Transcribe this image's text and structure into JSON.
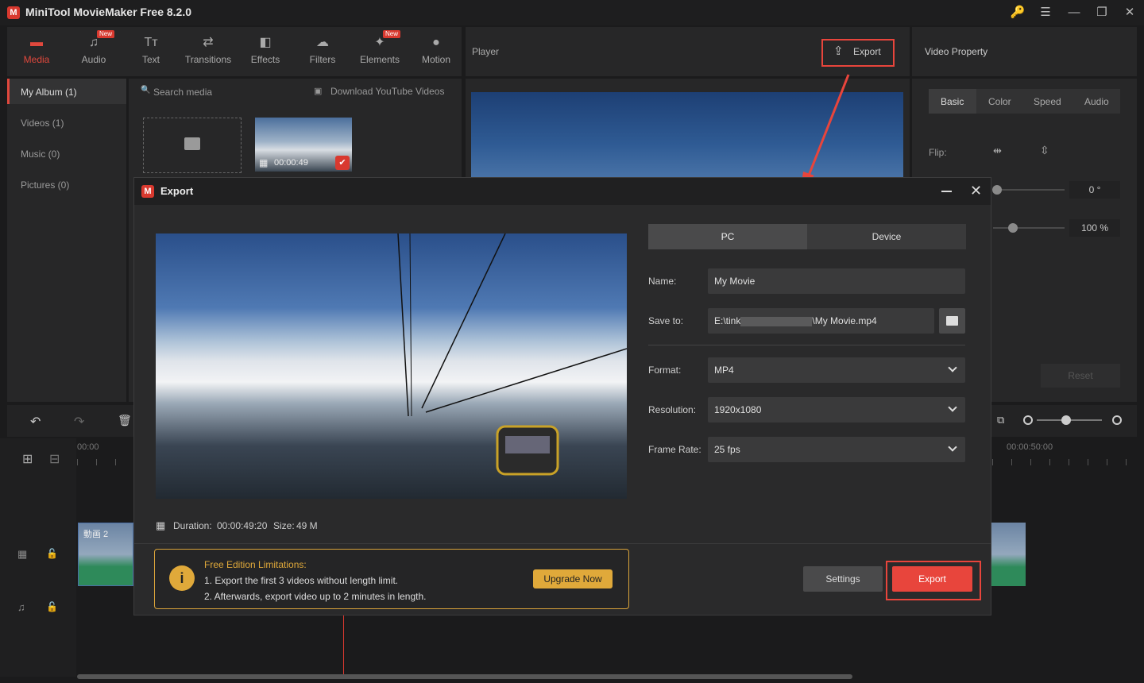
{
  "app": {
    "title": "MiniTool MovieMaker Free 8.2.0",
    "logo_letter": "M"
  },
  "window_controls": {
    "key": "🔑",
    "menu": "☰",
    "minimize": "—",
    "maximize": "❐",
    "close": "✕"
  },
  "toolbar": {
    "items": [
      {
        "label": "Media",
        "icon": "media-icon",
        "glyph": "▬",
        "active": true
      },
      {
        "label": "Audio",
        "icon": "music-note-icon",
        "glyph": "♫",
        "badge": "New"
      },
      {
        "label": "Text",
        "icon": "text-icon",
        "glyph": "Tт"
      },
      {
        "label": "Transitions",
        "icon": "transitions-icon",
        "glyph": "⇄"
      },
      {
        "label": "Effects",
        "icon": "effects-icon",
        "glyph": "◧"
      },
      {
        "label": "Filters",
        "icon": "filters-icon",
        "glyph": "☁"
      },
      {
        "label": "Elements",
        "icon": "elements-icon",
        "glyph": "✦",
        "badge": "New"
      },
      {
        "label": "Motion",
        "icon": "motion-icon",
        "glyph": "●"
      }
    ],
    "accent": "#e0483d"
  },
  "library": {
    "items": [
      "My Album (1)",
      "Videos (1)",
      "Music (0)",
      "Pictures (0)"
    ],
    "search_placeholder": "Search media",
    "download_label": "Download YouTube Videos",
    "clip_duration": "00:00:49"
  },
  "player": {
    "label": "Player",
    "export_label": "Export"
  },
  "property": {
    "title": "Video Property",
    "tabs": [
      "Basic",
      "Color",
      "Speed",
      "Audio"
    ],
    "flip_label": "Flip:",
    "rotate_value": "0 °",
    "scale_value": "100 %",
    "reset_label": "Reset"
  },
  "timeline": {
    "time_start": "00:00",
    "time_end": "00:00:50:00",
    "clip_label": "動画 2"
  },
  "export_dialog": {
    "title": "Export",
    "tabs": [
      "PC",
      "Device"
    ],
    "name_label": "Name:",
    "name_value": "My Movie",
    "save_label": "Save to:",
    "save_value_start": "E:\\tink",
    "save_value_end": "\\My Movie.mp4",
    "format_label": "Format:",
    "format_value": "MP4",
    "resolution_label": "Resolution:",
    "resolution_value": "1920x1080",
    "framerate_label": "Frame Rate:",
    "framerate_value": "25 fps",
    "duration_label": "Duration:",
    "duration_value": "00:00:49:20",
    "size_label": "Size:",
    "size_value": "49 M",
    "limit_title": "Free Edition Limitations:",
    "limit_line1": "1. Export the first 3 videos without length limit.",
    "limit_line2": "2. Afterwards, export video up to 2 minutes in length.",
    "upgrade_label": "Upgrade Now",
    "settings_label": "Settings",
    "export_label": "Export"
  },
  "colors": {
    "accent_red": "#e8453c",
    "warning_gold": "#e0a93a",
    "highlight_box": "#e8453c"
  }
}
